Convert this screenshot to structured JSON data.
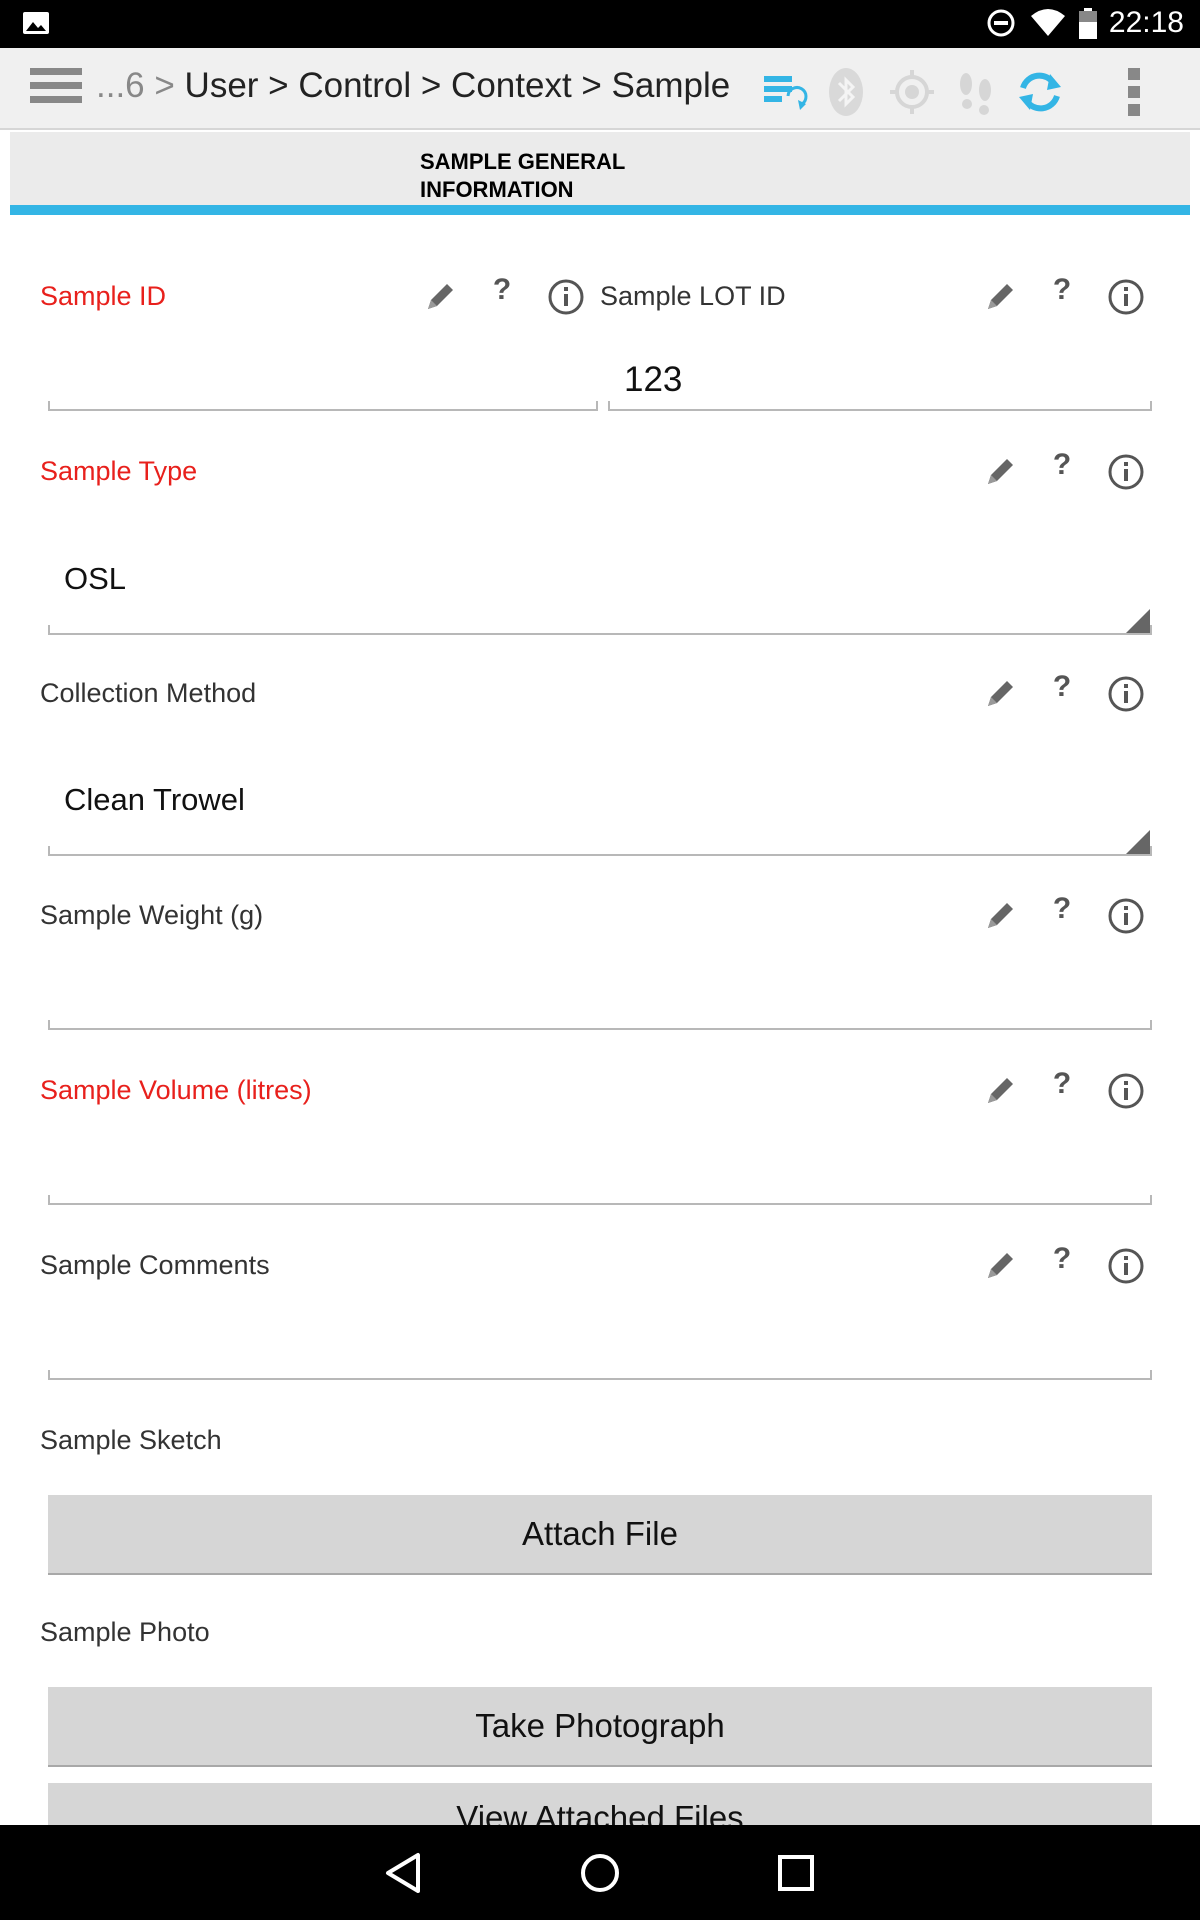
{
  "status_bar": {
    "time": "22:18",
    "icons": [
      "gallery-icon",
      "do-not-disturb-icon",
      "wifi-icon",
      "battery-icon"
    ]
  },
  "action_bar": {
    "breadcrumb_prefix": "...6 >",
    "breadcrumb_path": "User > Control > Context > Sample",
    "icons": [
      "sync-records-icon",
      "bluetooth-icon",
      "gps-icon",
      "tracker-icon",
      "refresh-icon",
      "overflow-menu-icon"
    ],
    "accent_color": "#33b5e5"
  },
  "tab": {
    "label_line1": "SAMPLE GENERAL",
    "label_line2": "INFORMATION"
  },
  "fields": {
    "sample_id": {
      "label": "Sample ID",
      "value": "",
      "required": true
    },
    "sample_lot_id": {
      "label": "Sample LOT ID",
      "value": "123",
      "required": false
    },
    "sample_type": {
      "label": "Sample Type",
      "value": "OSL",
      "required": true
    },
    "collection_method": {
      "label": "Collection Method",
      "value": "Clean Trowel",
      "required": false
    },
    "sample_weight": {
      "label": "Sample Weight (g)",
      "value": "",
      "required": false
    },
    "sample_volume": {
      "label": "Sample Volume (litres)",
      "value": "",
      "required": true
    },
    "sample_comments": {
      "label": "Sample Comments",
      "value": "",
      "required": false
    },
    "sample_sketch": {
      "label": "Sample Sketch",
      "button": "Attach File"
    },
    "sample_photo": {
      "label": "Sample Photo",
      "button": "Take Photograph",
      "secondary_button": "View Attached Files"
    }
  },
  "field_icons": [
    "pencil-icon",
    "help-icon",
    "info-icon"
  ],
  "required_color": "#e8201c"
}
